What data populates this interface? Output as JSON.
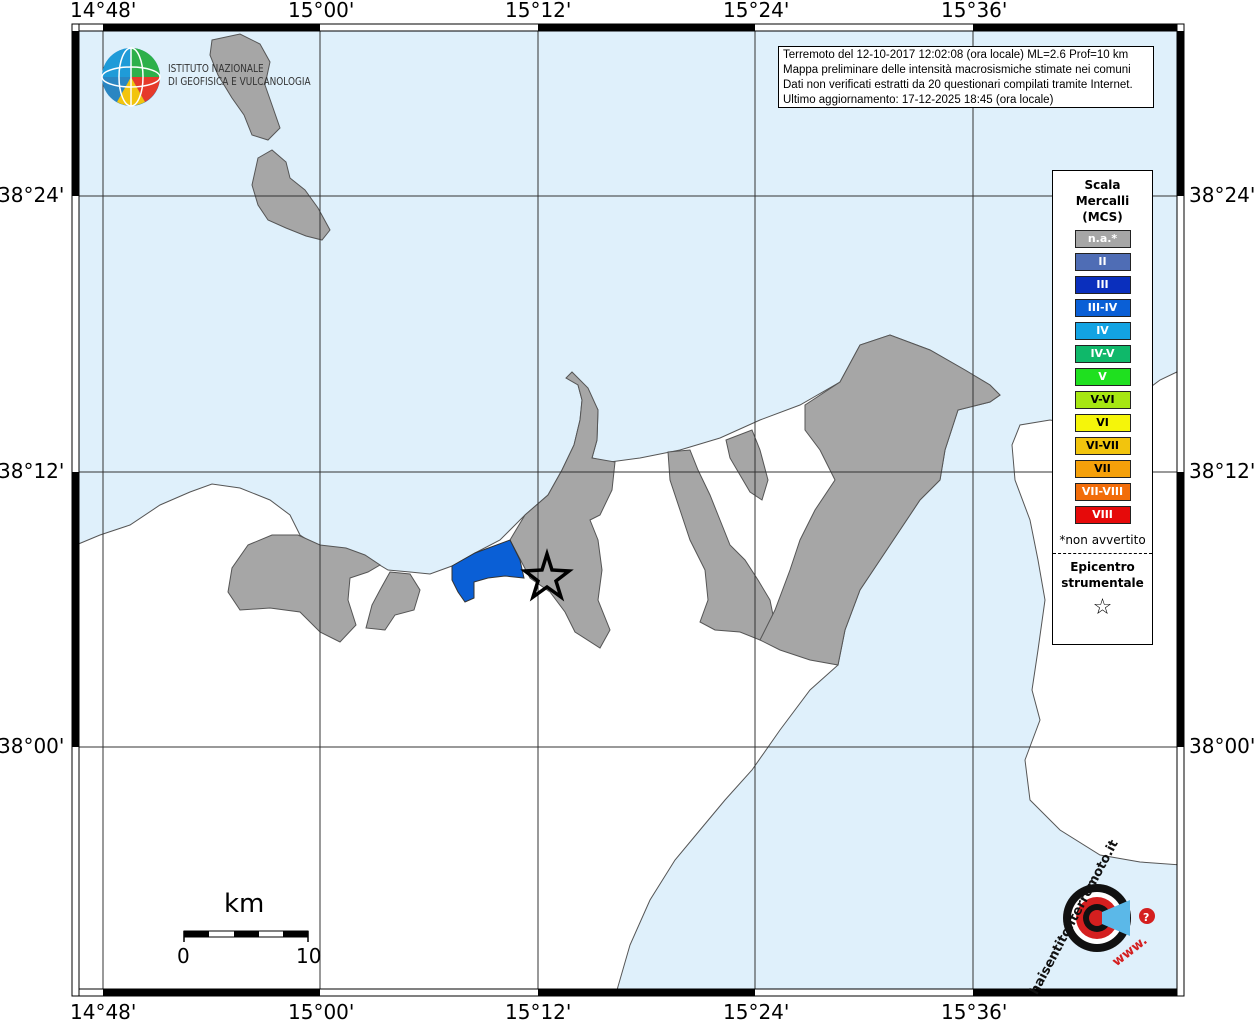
{
  "info": {
    "line1": "Terremoto del 12-10-2017 12:02:08 (ora locale) ML=2.6 Prof=10 km",
    "line2": "Mappa preliminare delle intensità macrosismiche stimate nei comuni",
    "line3": "Dati non verificati estratti da 20 questionari compilati tramite Internet.",
    "line4": "Ultimo aggiornamento: 17-12-2025 18:45 (ora locale)"
  },
  "ingv": {
    "line1": "ISTITUTO NAZIONALE",
    "line2": "DI GEOFISICA E VULCANOLOGIA"
  },
  "longitude_labels": [
    "14°48'",
    "15°00'",
    "15°12'",
    "15°24'",
    "15°36'"
  ],
  "latitude_labels": [
    "38°24'",
    "38°12'",
    "38°00'"
  ],
  "legend": {
    "title_line1": "Scala",
    "title_line2": "Mercalli",
    "title_line3": "(MCS)",
    "items": [
      {
        "label": "n.a.*",
        "color": "#a6a6a6"
      },
      {
        "label": "II",
        "color": "#4f6db5"
      },
      {
        "label": "III",
        "color": "#0a2fbd"
      },
      {
        "label": "III-IV",
        "color": "#0a5fd6"
      },
      {
        "label": "IV",
        "color": "#12a3e3"
      },
      {
        "label": "IV-V",
        "color": "#0fb86a"
      },
      {
        "label": "V",
        "color": "#1fe01f"
      },
      {
        "label": "V-VI",
        "color": "#a6e612"
      },
      {
        "label": "VI",
        "color": "#f5f50a"
      },
      {
        "label": "VI-VII",
        "color": "#f2c40d"
      },
      {
        "label": "VII",
        "color": "#f5a00a"
      },
      {
        "label": "VII-VIII",
        "color": "#f26d0a"
      },
      {
        "label": "VIII",
        "color": "#e60a0a"
      }
    ],
    "note": "*non avvertito",
    "epicentre_line1": "Epicentro",
    "epicentre_line2": "strumentale",
    "star_symbol": "☆"
  },
  "scale_bar": {
    "title": "km",
    "min_label": "0",
    "max_label": "10"
  },
  "colors": {
    "sea": "#dff0fb",
    "land": "#ffffff",
    "no_data": "#a6a6a6",
    "intensity_iii_iv": "#0a5fd6"
  },
  "hsit_logo": {
    "text": "haisentitoilterremoto.it",
    "prefix": "www."
  }
}
